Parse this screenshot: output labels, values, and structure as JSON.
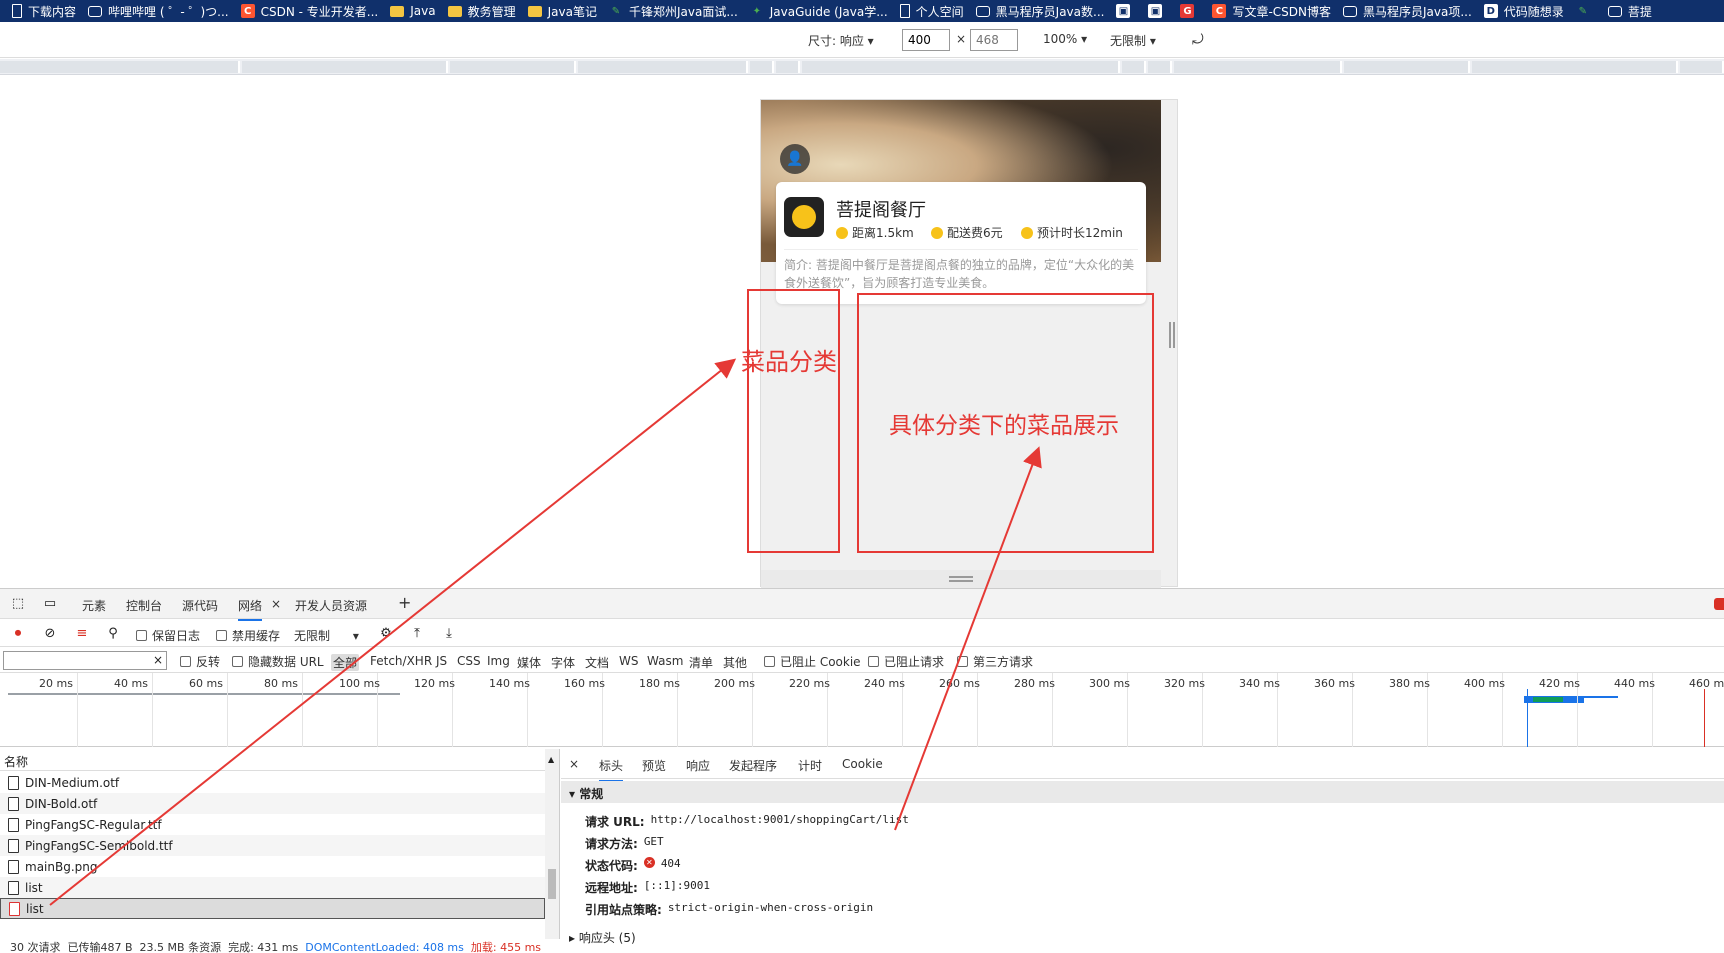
{
  "bookmarks": [
    {
      "icon": "doc-icon",
      "label": "下载内容"
    },
    {
      "icon": "bilibili-icon",
      "label": "哔哩哔哩 ( ゜- ゜)つ..."
    },
    {
      "icon": "csdn-icon",
      "label": "CSDN - 专业开发者..."
    },
    {
      "icon": "folder-icon",
      "label": "Java"
    },
    {
      "icon": "folder-icon",
      "label": "教务管理"
    },
    {
      "icon": "folder-icon",
      "label": "Java笔记"
    },
    {
      "icon": "leaf-icon",
      "label": "千锋郑州Java面试..."
    },
    {
      "icon": "javaguide-icon",
      "label": "JavaGuide (Java学..."
    },
    {
      "icon": "doc-icon",
      "label": "个人空间"
    },
    {
      "icon": "bilibili-icon",
      "label": "黑马程序员Java数..."
    },
    {
      "icon": "app-icon",
      "label": ""
    },
    {
      "icon": "app-icon",
      "label": ""
    },
    {
      "icon": "g-icon",
      "label": ""
    },
    {
      "icon": "csdn-icon",
      "label": "写文章-CSDN博客"
    },
    {
      "icon": "bilibili-icon",
      "label": "黑马程序员Java项..."
    },
    {
      "icon": "code-icon",
      "label": "代码随想录"
    },
    {
      "icon": "leaf-icon",
      "label": ""
    },
    {
      "icon": "bilibili-icon",
      "label": "菩提"
    }
  ],
  "device_toolbar": {
    "size_label": "尺寸: 响应",
    "width_value": "400",
    "height_placeholder": "468",
    "times": "×",
    "zoom": "100%",
    "throttle": "无限制"
  },
  "phone": {
    "store_name": "菩提阁餐厅",
    "distance": "距离1.5km",
    "delivery_fee": "配送费6元",
    "eta": "预计时长12min",
    "description": "简介: 菩提阁中餐厅是菩提阁点餐的独立的品牌，定位“大众化的美食外送餐饮”，旨为顾客打造专业美食。"
  },
  "annotations": {
    "category_label": "菜品分类",
    "dishes_label": "具体分类下的菜品展示"
  },
  "devtools": {
    "tabs": [
      "元素",
      "控制台",
      "源代码",
      "网络",
      "开发人员资源"
    ],
    "active_tab": "网络",
    "close_glyph": "×",
    "add_glyph": "+",
    "network_toolbar": {
      "preserve_log": "保留日志",
      "disable_cache": "禁用缓存",
      "throttle": "无限制"
    },
    "filter_bar": {
      "invert": "反转",
      "hide_data_urls": "隐藏数据 URL",
      "types": [
        "全部",
        "Fetch/XHR",
        "JS",
        "CSS",
        "Img",
        "媒体",
        "字体",
        "文档",
        "WS",
        "Wasm",
        "清单",
        "其他"
      ],
      "selected_type": "全部",
      "blocked_cookies": "已阻止 Cookie",
      "blocked_requests": "已阻止请求",
      "third_party": "第三方请求"
    },
    "timeline_ticks": [
      "20 ms",
      "40 ms",
      "60 ms",
      "80 ms",
      "100 ms",
      "120 ms",
      "140 ms",
      "160 ms",
      "180 ms",
      "200 ms",
      "220 ms",
      "240 ms",
      "260 ms",
      "280 ms",
      "300 ms",
      "320 ms",
      "340 ms",
      "360 ms",
      "380 ms",
      "400 ms",
      "420 ms",
      "440 ms",
      "460 ms"
    ],
    "request_list": {
      "header": "名称",
      "rows": [
        {
          "name": "DIN-Medium.otf",
          "error": false
        },
        {
          "name": "DIN-Bold.otf",
          "error": false
        },
        {
          "name": "PingFangSC-Regular.ttf",
          "error": false
        },
        {
          "name": "PingFangSC-Semibold.ttf",
          "error": false
        },
        {
          "name": "mainBg.png",
          "error": false
        },
        {
          "name": "list",
          "error": false
        },
        {
          "name": "list",
          "error": true
        }
      ]
    },
    "detail": {
      "tabs": [
        "标头",
        "预览",
        "响应",
        "发起程序",
        "计时",
        "Cookie"
      ],
      "active_tab": "标头",
      "section": "常规",
      "request_url_label": "请求 URL:",
      "request_url": "http://localhost:9001/shoppingCart/list",
      "method_label": "请求方法:",
      "method": "GET",
      "status_label": "状态代码:",
      "status": "404",
      "remote_label": "远程地址:",
      "remote": "[::1]:9001",
      "referrer_label": "引用站点策略:",
      "referrer": "strict-origin-when-cross-origin",
      "response_headers": "响应头 (5)"
    },
    "status_bar": {
      "requests": "30 次请求",
      "transferred": "已传输487 B",
      "resources": "23.5 MB 条资源",
      "finish": "完成: 431 ms",
      "dcl": "DOMContentLoaded: 408 ms",
      "load": "加载: 455 ms"
    }
  },
  "colors": {
    "bookmark_bar": "#10306b",
    "annotation": "#e53935",
    "accent": "#1a73e8",
    "error": "#d93025"
  }
}
